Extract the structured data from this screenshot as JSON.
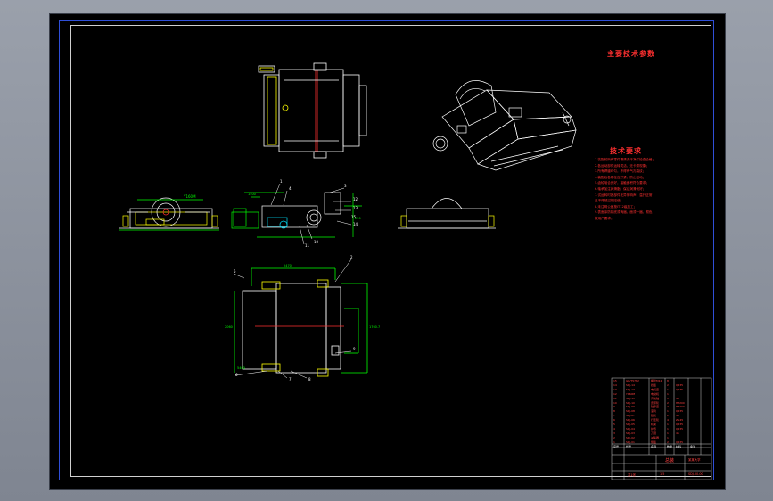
{
  "drawing": {
    "tech_params_title": "主要技术参数",
    "tech_requirements_title": "技术要求",
    "tech_requirements": [
      "1.装配前所有零件需清洗干净并检查合格；",
      "2.各运动部件运转灵活，无卡滞现象；",
      "3.所有焊缝均匀，不得有气孔裂纹；",
      "4.装配后各螺栓应拧紧，防止松动；",
      "5.齿轮啮合良好，接触面积符合要求；",
      "6.轴承加注润滑脂，保证润滑良好；",
      "7.试运转时各部件无异常响声，温升正常",
      "  且不得超过规定值；",
      "8.未注明公差按IT12级加工；",
      "9.表面涂防锈底漆两遍，面漆一遍，颜色",
      "  按用户要求。"
    ],
    "balloons": [
      "1",
      "2",
      "3",
      "4",
      "5",
      "6",
      "7",
      "8",
      "9",
      "10",
      "11",
      "12",
      "13",
      "14",
      "15"
    ],
    "dimensions": {
      "side_height": "250",
      "side_width": "1500",
      "plan_width": "2470",
      "plan_height": "2060",
      "plan_right": "1760.7",
      "plan_bottom": "5400",
      "motor_label": "Y160M"
    }
  },
  "title_block": {
    "parts_rows": [
      [
        "15",
        "GB/T5782",
        "螺栓M12",
        "8",
        "",
        ""
      ],
      [
        "14",
        "SDJ-14",
        "挡板",
        "2",
        "Q235",
        ""
      ],
      [
        "13",
        "SDJ-13",
        "电机座",
        "1",
        "Q235",
        ""
      ],
      [
        "12",
        "Y160M",
        "电动机",
        "1",
        "",
        ""
      ],
      [
        "11",
        "SDJ-11",
        "传动轴",
        "1",
        "45",
        ""
      ],
      [
        "10",
        "SDJ-10",
        "皮带轮",
        "2",
        "HT200",
        ""
      ],
      [
        "9",
        "SDJ-09",
        "轴承座",
        "4",
        "HT200",
        ""
      ],
      [
        "8",
        "SDJ-08",
        "滚筒",
        "1",
        "Q235",
        ""
      ],
      [
        "7",
        "SDJ-07",
        "链轮",
        "2",
        "45",
        ""
      ],
      [
        "6",
        "SDJ-06",
        "行走轮",
        "4",
        "ZG45",
        ""
      ],
      [
        "5",
        "SDJ-05",
        "机架",
        "1",
        "Q235",
        ""
      ],
      [
        "4",
        "SDJ-04",
        "护罩",
        "1",
        "Q235",
        ""
      ],
      [
        "3",
        "SDJ-03",
        "刀辊",
        "1",
        "45",
        ""
      ],
      [
        "2",
        "SDJ-02",
        "减速器",
        "1",
        "",
        ""
      ],
      [
        "1",
        "SDJ-01",
        "侧板",
        "2",
        "Q235",
        ""
      ]
    ],
    "header": [
      "序号",
      "代号",
      "名称",
      "数量",
      "材料",
      "备注"
    ],
    "drawing_name": "总装",
    "school": "某某大学",
    "drawing_no": "SDJ-00-00",
    "scale": "1:5",
    "sheet": "共1张"
  },
  "colors": {
    "background": "#000000",
    "outline": "#ffffff",
    "dimension": "#00ff00",
    "centerline": "#ff3030",
    "annotation": "#ff3030",
    "border": "#2f4fd8",
    "hidden": "#00e5ff",
    "yellow": "#ffff00"
  }
}
